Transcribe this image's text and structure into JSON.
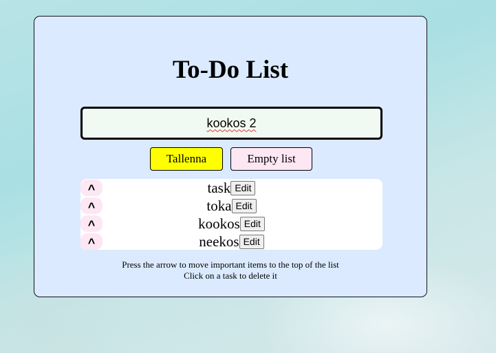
{
  "app": {
    "title": "To-Do List"
  },
  "input": {
    "value": "kookos 2"
  },
  "buttons": {
    "save_label": "Tallenna",
    "empty_label": "Empty list"
  },
  "tasks": [
    {
      "text": "task",
      "up_label": "^",
      "edit_label": "Edit"
    },
    {
      "text": "toka",
      "up_label": "^",
      "edit_label": "Edit"
    },
    {
      "text": "kookos",
      "up_label": "^",
      "edit_label": "Edit"
    },
    {
      "text": "neekos",
      "up_label": "^",
      "edit_label": "Edit"
    }
  ],
  "instructions": {
    "line1": "Press the arrow to move important items to the top of the list",
    "line2": "Click on a task to delete it"
  },
  "colors": {
    "card_background": "#dbeafe",
    "input_background": "#f1faf2",
    "save_button": "#ffff00",
    "empty_button": "#fce7f3",
    "arrow_button": "#fce7f3"
  }
}
